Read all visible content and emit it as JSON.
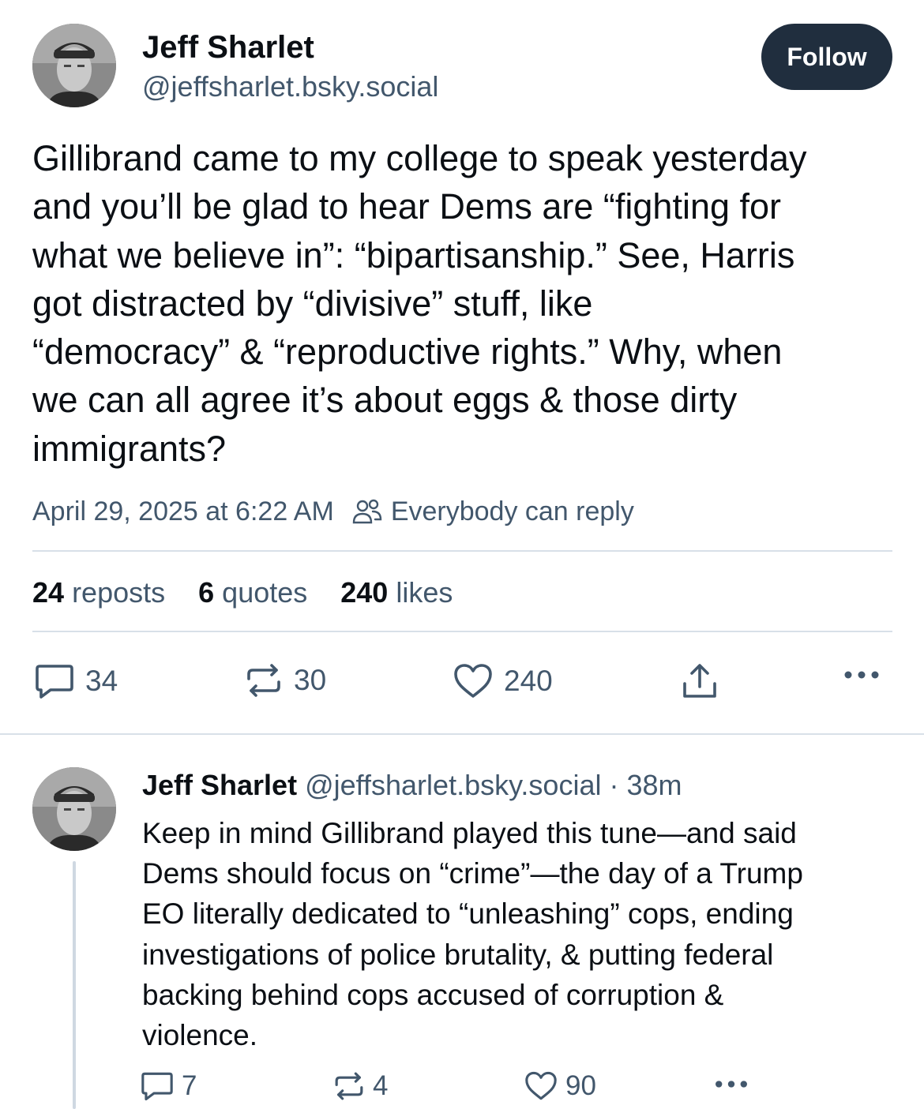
{
  "post": {
    "author_name": "Jeff Sharlet",
    "author_handle": "@jeffsharlet.bsky.social",
    "follow_label": "Follow",
    "text": "Gillibrand came to my college to speak yesterday\nand you’ll be glad to hear Dems are “fighting for\nwhat we believe in”: “bipartisanship.” See, Harris\ngot distracted by “divisive” stuff, like\n“democracy” & “reproductive rights.” Why, when\nwe can all agree it’s about eggs & those dirty\nimmigrants?",
    "timestamp": "April 29, 2025 at 6:22 AM",
    "reply_setting": "Everybody can reply",
    "stats": {
      "reposts_count": "24",
      "reposts_label": "reposts",
      "quotes_count": "6",
      "quotes_label": "quotes",
      "likes_count": "240",
      "likes_label": "likes"
    },
    "actions": {
      "reply_count": "34",
      "repost_count": "30",
      "like_count": "240"
    }
  },
  "reply": {
    "author_name": "Jeff Sharlet",
    "author_handle": "@jeffsharlet.bsky.social",
    "separator": "·",
    "time_ago": "38m",
    "text": "Keep in mind Gillibrand played this tune—and said\nDems should focus on “crime”—the day of a Trump\nEO literally dedicated to “unleashing” cops, ending\ninvestigations of police brutality, & putting federal\nbacking behind cops accused of corruption &\nviolence.",
    "actions": {
      "reply_count": "7",
      "repost_count": "4",
      "like_count": "90"
    }
  },
  "icons": {
    "avatar": "avatar-photo",
    "reply": "speech-bubble-icon",
    "repost": "repost-arrows-icon",
    "like": "heart-icon",
    "share": "share-upload-icon",
    "more": "ellipsis-icon",
    "people": "people-icon"
  },
  "colors": {
    "text_primary": "#0b0f14",
    "text_secondary": "#42576c",
    "follow_button_bg": "#202e3e",
    "divider": "#d8e0e8",
    "thread_line": "#cfd8e2"
  }
}
